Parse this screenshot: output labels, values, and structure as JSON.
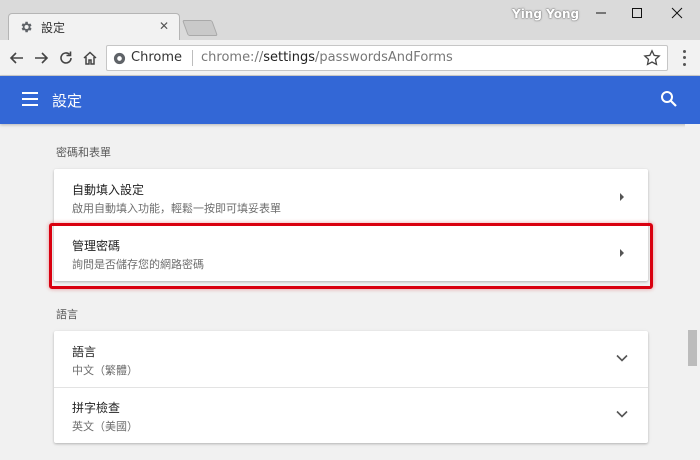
{
  "window": {
    "profile_name": "Ying Yong",
    "tab": {
      "title": "設定",
      "icon": "gear-icon",
      "close_icon": "close-icon"
    }
  },
  "toolbar": {
    "site_chip": "Chrome",
    "url_prefix": "chrome://",
    "url_bold": "settings",
    "url_suffix": "/passwordsAndForms",
    "icons": [
      "back-arrow-icon",
      "forward-arrow-icon",
      "reload-icon",
      "home-icon",
      "star-icon",
      "more-vert-icon"
    ]
  },
  "header": {
    "title": "設定",
    "accent_color": "#3367d6"
  },
  "sections": {
    "passwords": {
      "title": "密碼和表單",
      "rows": [
        {
          "title": "自動填入設定",
          "subtitle": "啟用自動填入功能，輕鬆一按即可填妥表單"
        },
        {
          "title": "管理密碼",
          "subtitle": "詢問是否儲存您的網路密碼"
        }
      ]
    },
    "languages": {
      "title": "語言",
      "rows": [
        {
          "title": "語言",
          "subtitle": "中文（繁體）"
        },
        {
          "title": "拼字檢查",
          "subtitle": "英文（美國）"
        }
      ]
    }
  },
  "highlight_color": "#d9000f"
}
